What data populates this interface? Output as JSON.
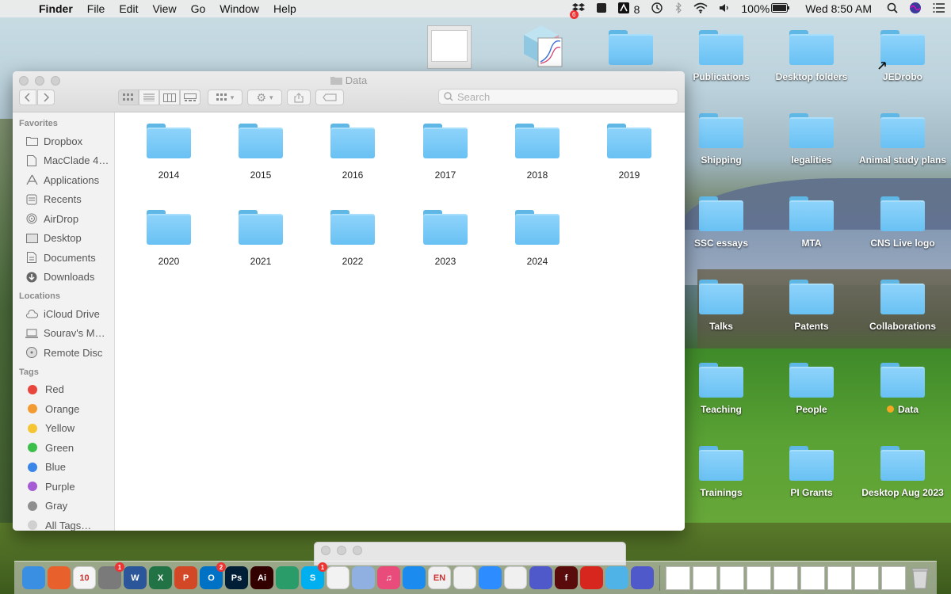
{
  "menubar": {
    "app_name": "Finder",
    "items": [
      "File",
      "Edit",
      "View",
      "Go",
      "Window",
      "Help"
    ],
    "status": {
      "dropbox_badge": "6",
      "adobe_count": "8",
      "battery": "100%",
      "clock": "Wed 8:50 AM"
    }
  },
  "window": {
    "title": "Data",
    "search_placeholder": "Search",
    "sidebar": {
      "favorites_header": "Favorites",
      "favorites": [
        {
          "label": "Dropbox",
          "icon": "folder-icon"
        },
        {
          "label": "MacClade 4…",
          "icon": "document-icon"
        },
        {
          "label": "Applications",
          "icon": "applications-icon"
        },
        {
          "label": "Recents",
          "icon": "recents-icon"
        },
        {
          "label": "AirDrop",
          "icon": "airdrop-icon"
        },
        {
          "label": "Desktop",
          "icon": "desktop-icon"
        },
        {
          "label": "Documents",
          "icon": "documents-icon"
        },
        {
          "label": "Downloads",
          "icon": "downloads-icon"
        }
      ],
      "locations_header": "Locations",
      "locations": [
        {
          "label": "iCloud Drive",
          "icon": "cloud-icon"
        },
        {
          "label": "Sourav's M…",
          "icon": "laptop-icon"
        },
        {
          "label": "Remote Disc",
          "icon": "disc-icon"
        }
      ],
      "tags_header": "Tags",
      "tags": [
        {
          "label": "Red",
          "color": "#e8453c"
        },
        {
          "label": "Orange",
          "color": "#f39b33"
        },
        {
          "label": "Yellow",
          "color": "#f5c533"
        },
        {
          "label": "Green",
          "color": "#3cbf4a"
        },
        {
          "label": "Blue",
          "color": "#3a86e8"
        },
        {
          "label": "Purple",
          "color": "#a55bd3"
        },
        {
          "label": "Gray",
          "color": "#8e8e8e"
        },
        {
          "label": "All Tags…",
          "color": "#d0d0d0"
        }
      ]
    },
    "folders": [
      "2014",
      "2015",
      "2016",
      "2017",
      "2018",
      "2019",
      "2020",
      "2021",
      "2022",
      "2023",
      "2024"
    ]
  },
  "desktop": {
    "icons": [
      {
        "label": "Publications"
      },
      {
        "label": "Desktop folders"
      },
      {
        "label": "JEDrobo"
      },
      {
        "label": "Shipping"
      },
      {
        "label": "legalities"
      },
      {
        "label": "Animal study plans"
      },
      {
        "label": "SSC essays"
      },
      {
        "label": "MTA"
      },
      {
        "label": "CNS Live logo"
      },
      {
        "label": "Talks"
      },
      {
        "label": "Patents"
      },
      {
        "label": "Collaborations"
      },
      {
        "label": "Teaching"
      },
      {
        "label": "People"
      },
      {
        "label": "Data",
        "tag_color": "#f5a623"
      },
      {
        "label": "Trainings"
      },
      {
        "label": "PI Grants"
      },
      {
        "label": "Desktop Aug 2023"
      }
    ]
  },
  "dock": {
    "apps": [
      {
        "name": "finder-icon",
        "color": "#3b8fe3",
        "text": ""
      },
      {
        "name": "firefox-icon",
        "color": "#e8612c",
        "text": ""
      },
      {
        "name": "calendar-icon",
        "color": "#f4f4f4",
        "text": "10"
      },
      {
        "name": "system-preferences-icon",
        "color": "#7a7a7a",
        "text": "",
        "badge": "1"
      },
      {
        "name": "word-icon",
        "color": "#2b579a",
        "text": "W"
      },
      {
        "name": "excel-icon",
        "color": "#217346",
        "text": "X"
      },
      {
        "name": "powerpoint-icon",
        "color": "#d24726",
        "text": "P"
      },
      {
        "name": "outlook-icon",
        "color": "#0072c6",
        "text": "O",
        "badge": "2"
      },
      {
        "name": "photoshop-icon",
        "color": "#001e36",
        "text": "Ps"
      },
      {
        "name": "illustrator-icon",
        "color": "#330000",
        "text": "Ai"
      },
      {
        "name": "network-app-icon",
        "color": "#2a9c6a",
        "text": ""
      },
      {
        "name": "skype-icon",
        "color": "#00aff0",
        "text": "S",
        "badge": "1"
      },
      {
        "name": "acrobat-icon",
        "color": "#f2f2f2",
        "text": ""
      },
      {
        "name": "cube-app-icon",
        "color": "#8fb0e0",
        "text": ""
      },
      {
        "name": "itunes-icon",
        "color": "#e94b7b",
        "text": "♫"
      },
      {
        "name": "safari-icon",
        "color": "#1c8bf0",
        "text": ""
      },
      {
        "name": "endnote-icon",
        "color": "#f0f0f0",
        "text": "EN"
      },
      {
        "name": "dna-app-icon",
        "color": "#f0f0f0",
        "text": ""
      },
      {
        "name": "zoom-icon",
        "color": "#2d8cff",
        "text": ""
      },
      {
        "name": "chrome-icon",
        "color": "#f0f0f0",
        "text": ""
      },
      {
        "name": "teams-icon",
        "color": "#5059c9",
        "text": ""
      },
      {
        "name": "flash-icon",
        "color": "#5a0b0b",
        "text": "f"
      },
      {
        "name": "acrobat-reader-icon",
        "color": "#d7261e",
        "text": ""
      },
      {
        "name": "pen-app-icon",
        "color": "#4fb3e8",
        "text": ""
      },
      {
        "name": "teams-alt-icon",
        "color": "#5059c9",
        "text": ""
      }
    ],
    "docs_count": 9
  }
}
